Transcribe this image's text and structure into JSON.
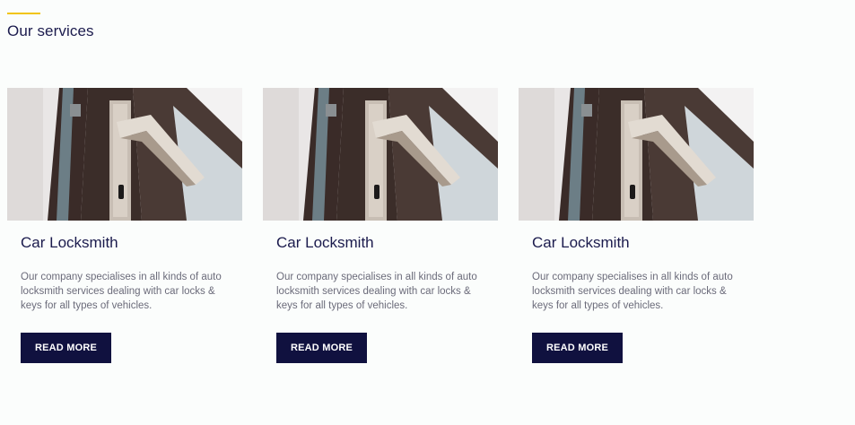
{
  "section": {
    "title": "Our services"
  },
  "colors": {
    "accent": "#f1c40f",
    "heading": "#1b1b4d",
    "button_bg": "#10113f",
    "text": "#6b6b7a"
  },
  "cards": [
    {
      "title": "Car Locksmith",
      "description": "Our company specialises in all kinds of auto locksmith services dealing with car locks & keys for all types of vehicles.",
      "button_label": "READ MORE",
      "image": "door-handle-photo"
    },
    {
      "title": "Car Locksmith",
      "description": "Our company specialises in all kinds of auto locksmith services dealing with car locks & keys for all types of vehicles.",
      "button_label": "READ MORE",
      "image": "door-handle-photo"
    },
    {
      "title": "Car Locksmith",
      "description": "Our company specialises in all kinds of auto locksmith services dealing with car locks & keys for all types of vehicles.",
      "button_label": "READ MORE",
      "image": "door-handle-photo"
    }
  ]
}
